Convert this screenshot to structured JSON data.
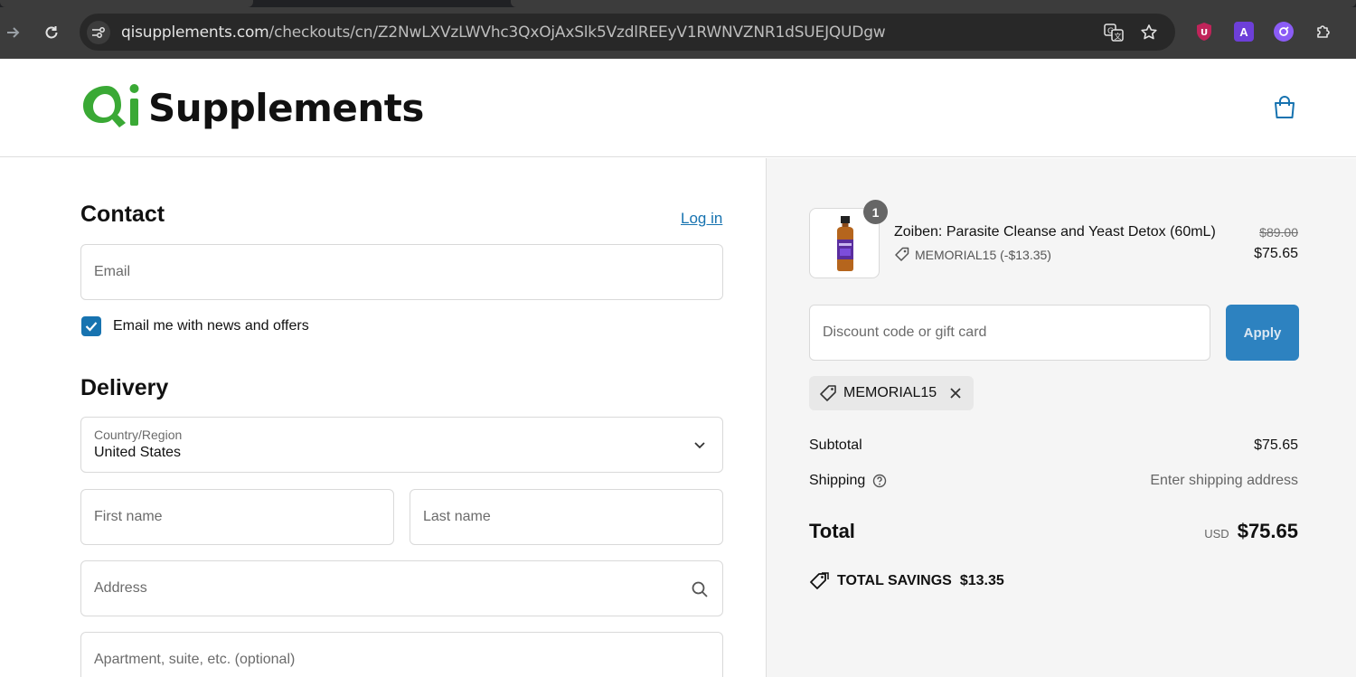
{
  "browser": {
    "url_host": "qisupplements.com",
    "url_path": "/checkouts/cn/Z2NwLXVzLWVhc3QxOjAxSlk5VzdlREEyV1RWNVZNR1dSUEJQUDgw",
    "extensions": [
      {
        "name": "ublock-icon",
        "letter": "U",
        "color": "#c0245a"
      },
      {
        "name": "extension-a-icon",
        "letter": "A",
        "color": "#6d3fd9"
      },
      {
        "name": "extension-purple-icon",
        "letter": "",
        "color": "#8b5cf6"
      }
    ]
  },
  "header": {
    "logo_text": "Supplements",
    "logo_mark_color": "#3aa935"
  },
  "contact": {
    "title": "Contact",
    "login_label": "Log in",
    "email_placeholder": "Email",
    "newsletter_label": "Email me with news and offers",
    "newsletter_checked": true
  },
  "delivery": {
    "title": "Delivery",
    "country_label": "Country/Region",
    "country_value": "United States",
    "first_name_placeholder": "First name",
    "last_name_placeholder": "Last name",
    "address_placeholder": "Address",
    "apartment_placeholder": "Apartment, suite, etc. (optional)"
  },
  "summary": {
    "item": {
      "quantity": "1",
      "name": "Zoiben: Parasite Cleanse and Yeast Detox (60mL)",
      "discount": "MEMORIAL15 (-$13.35)",
      "original_price": "$89.00",
      "price": "$75.65"
    },
    "discount_placeholder": "Discount code or gift card",
    "apply_label": "Apply",
    "applied_code": "MEMORIAL15",
    "subtotal_label": "Subtotal",
    "subtotal_value": "$75.65",
    "shipping_label": "Shipping",
    "shipping_value": "Enter shipping address",
    "total_label": "Total",
    "total_currency": "USD",
    "total_value": "$75.65",
    "savings_label": "TOTAL SAVINGS",
    "savings_value": "$13.35"
  },
  "colors": {
    "accent": "#1773b0",
    "apply_button": "#2d82c0",
    "summary_bg": "#f5f5f5"
  }
}
